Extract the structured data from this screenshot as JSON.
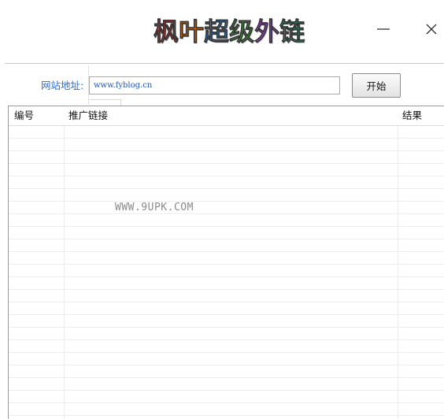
{
  "window": {
    "title_chars": [
      "枫",
      "叶",
      "超",
      "级",
      "外",
      "链"
    ],
    "title_colors": [
      "#e8262b",
      "#f07b13",
      "#2c86e0",
      "#3aa336",
      "#a23bd6",
      "#1fae7a"
    ],
    "minimize_icon": "minimize-icon",
    "close_icon": "close-icon"
  },
  "form": {
    "url_label": "网站地址:",
    "url_value": "www.fyblog.cn",
    "start_label": "开始"
  },
  "table": {
    "columns": [
      "编号",
      "推广链接",
      "结果"
    ],
    "rows": []
  },
  "watermark": "WWW.9UPK.COM"
}
